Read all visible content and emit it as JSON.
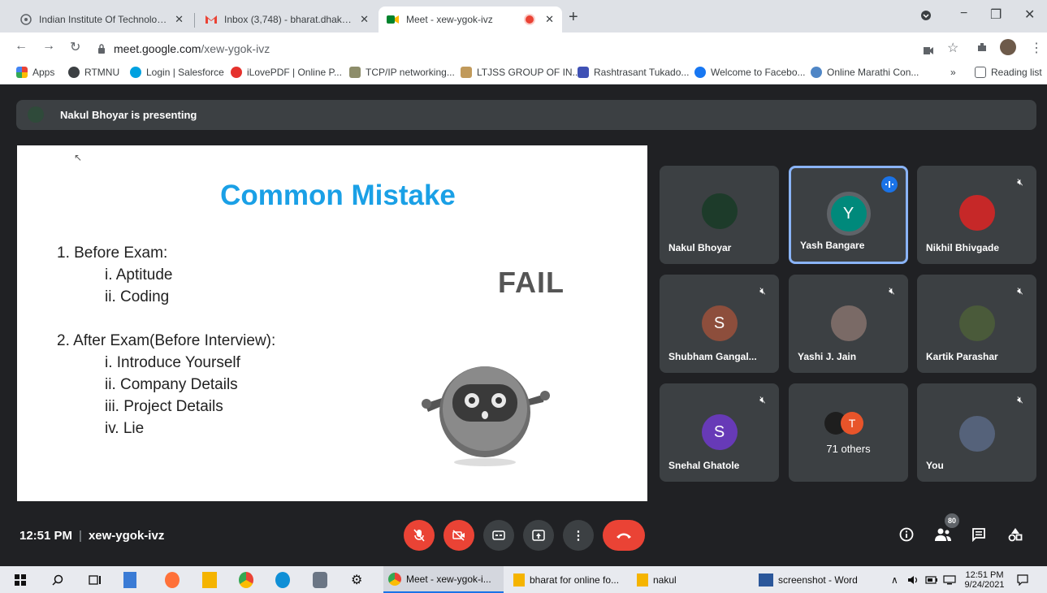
{
  "tabs": [
    {
      "title": "Indian Institute Of Technology, G"
    },
    {
      "title": "Inbox (3,748) - bharat.dhak@gm"
    },
    {
      "title": "Meet - xew-ygok-ivz"
    }
  ],
  "tab_close": "✕",
  "new_tab": "+",
  "window_controls": {
    "minimize": "−",
    "maximize": "❐",
    "close": "✕"
  },
  "address": {
    "host": "meet.google.com",
    "path": "/xew-ygok-ivz"
  },
  "bookmarks": [
    "Apps",
    "RTMNU",
    "Login | Salesforce",
    "iLovePDF | Online P...",
    "TCP/IP networking...",
    "LTJSS GROUP OF IN...",
    "Rashtrasant Tukado...",
    "Welcome to Facebo...",
    "Online Marathi Con..."
  ],
  "bookmarks_more": "»",
  "reading_list": "Reading list",
  "presenting": "Nakul Bhoyar is presenting",
  "slide": {
    "title": "Common Mistake",
    "lines": [
      "1. Before Exam:",
      "i. Aptitude",
      "ii. Coding",
      "2. After Exam(Before Interview):",
      "i. Introduce Yourself",
      "ii. Company Details",
      "iii. Project Details",
      "iv. Lie"
    ],
    "fail": "FAIL"
  },
  "participants": [
    {
      "name": "Nakul Bhoyar"
    },
    {
      "name": "Yash Bangare",
      "initial": "Y"
    },
    {
      "name": "Nikhil Bhivgade"
    },
    {
      "name": "Shubham Gangal...",
      "initial": "S"
    },
    {
      "name": "Yashi J. Jain"
    },
    {
      "name": "Kartik Parashar"
    },
    {
      "name": "Snehal Ghatole",
      "initial": "S"
    },
    {
      "name": "71 others",
      "initial": "T"
    },
    {
      "name": "You"
    }
  ],
  "bottom": {
    "time": "12:51 PM",
    "pipe": "|",
    "code": "xew-ygok-ivz",
    "people_count": "80"
  },
  "taskbar": {
    "apps": [
      "Meet - xew-ygok-i...",
      "bharat for online fo...",
      "nakul",
      "screenshot - Word"
    ],
    "time": "12:51 PM",
    "date": "9/24/2021"
  },
  "colors": {
    "accent": "#1aa0e6",
    "danger": "#ea4335",
    "speaker_border": "#8ab4f8",
    "purple": "#673ab7",
    "teal": "#00897b",
    "brown": "#8d4e3c"
  }
}
